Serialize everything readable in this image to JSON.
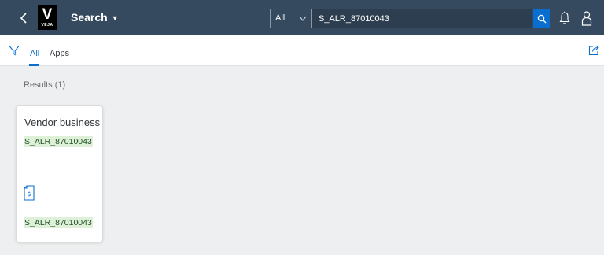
{
  "shell": {
    "logo_letter": "V",
    "logo_word": "VEJA",
    "app_title": "Search",
    "search_scope": "All",
    "search_value": "S_ALR_87010043"
  },
  "icons": {
    "back": "chevron-left-icon",
    "title_menu": "caret-down-icon",
    "scope": "chevron-down-icon",
    "search": "search-icon",
    "notifications": "bell-icon",
    "user": "user-icon",
    "filter": "filter-icon",
    "share": "share-icon",
    "app_tile": "document-dollar-icon"
  },
  "tabs": [
    {
      "label": "All",
      "active": true
    },
    {
      "label": "Apps",
      "active": false
    }
  ],
  "results": {
    "label": "Results (1)",
    "items": [
      {
        "title": "Vendor business",
        "subtitle": "S_ALR_87010043",
        "footer": "S_ALR_87010043"
      }
    ]
  },
  "colors": {
    "shellbar": "#354a5f",
    "accent": "#0a6ed1",
    "highlight": "#dff0d8"
  }
}
